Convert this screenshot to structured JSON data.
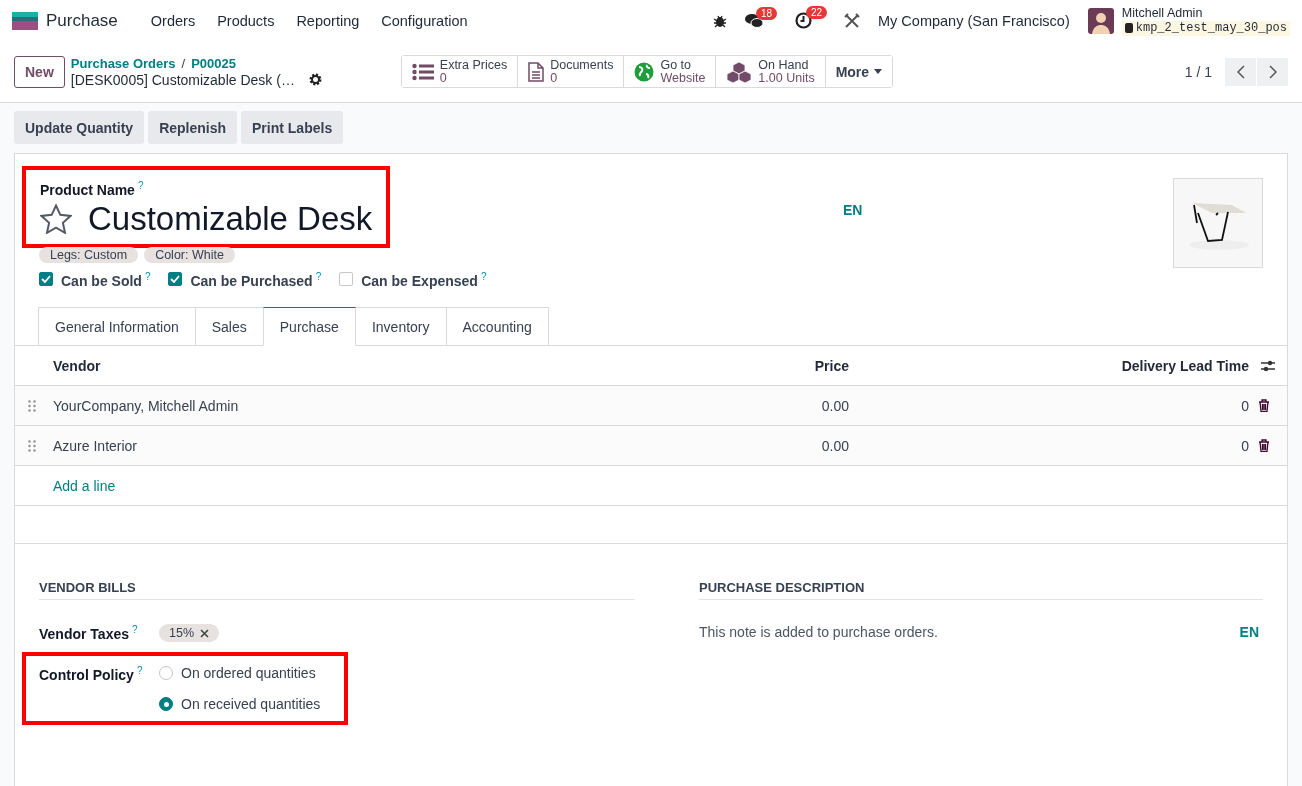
{
  "app": {
    "name": "Purchase"
  },
  "menu": [
    "Orders",
    "Products",
    "Reporting",
    "Configuration"
  ],
  "systray": {
    "message_count": "18",
    "activity_count": "22",
    "company": "My Company (San Francisco)",
    "user": "Mitchell Admin",
    "database": "kmp_2_test_may_30_pos"
  },
  "control_panel": {
    "new_button": "New",
    "breadcrumbs": [
      "Purchase Orders",
      "P00025"
    ],
    "separator": "/",
    "record_title": "[DESK0005] Customizable Desk (…",
    "smart_buttons": [
      {
        "kind": "list",
        "label": "Extra Prices",
        "value": "0"
      },
      {
        "kind": "document",
        "label": "Documents",
        "value": "0"
      },
      {
        "kind": "globe",
        "label": "Go to",
        "value": "Website"
      },
      {
        "kind": "boxes",
        "label": "On Hand",
        "value": "1.00 Units"
      }
    ],
    "more": "More",
    "pager": "1 / 1"
  },
  "actions": [
    "Update Quantity",
    "Replenish",
    "Print Labels"
  ],
  "product": {
    "name_label": "Product Name",
    "help": "?",
    "name": "Customizable Desk",
    "starred": false,
    "language": "EN",
    "image": {
      "kind": "picture"
    },
    "attributes": [
      "Legs: Custom",
      "Color: White"
    ],
    "options": [
      {
        "label": "Can be Sold",
        "help": "?",
        "checked": true
      },
      {
        "label": "Can be Purchased",
        "help": "?",
        "checked": true
      },
      {
        "label": "Can be Expensed",
        "help": "?",
        "checked": false
      }
    ]
  },
  "tabs": [
    {
      "label": "General Information",
      "selected": false
    },
    {
      "label": "Sales",
      "selected": false
    },
    {
      "label": "Purchase",
      "selected": true
    },
    {
      "label": "Inventory",
      "selected": false
    },
    {
      "label": "Accounting",
      "selected": false
    }
  ],
  "vendor_table": {
    "columns": [
      "Vendor",
      "Price",
      "Delivery Lead Time"
    ],
    "rows": [
      {
        "vendor": "YourCompany, Mitchell Admin",
        "price": "0.00",
        "lead_time": "0"
      },
      {
        "vendor": "Azure Interior",
        "price": "0.00",
        "lead_time": "0"
      }
    ],
    "add_line": "Add a line"
  },
  "vendor_bills": {
    "title": "VENDOR BILLS",
    "taxes_label": "Vendor Taxes",
    "taxes_help": "?",
    "taxes": [
      "15%"
    ],
    "control_policy_label": "Control Policy",
    "control_policy_help": "?",
    "policies": [
      {
        "label": "On ordered quantities",
        "selected": false
      },
      {
        "label": "On received quantities",
        "selected": true
      }
    ]
  },
  "purchase_description": {
    "title": "PURCHASE DESCRIPTION",
    "placeholder": "This note is added to purchase orders.",
    "language": "EN"
  }
}
